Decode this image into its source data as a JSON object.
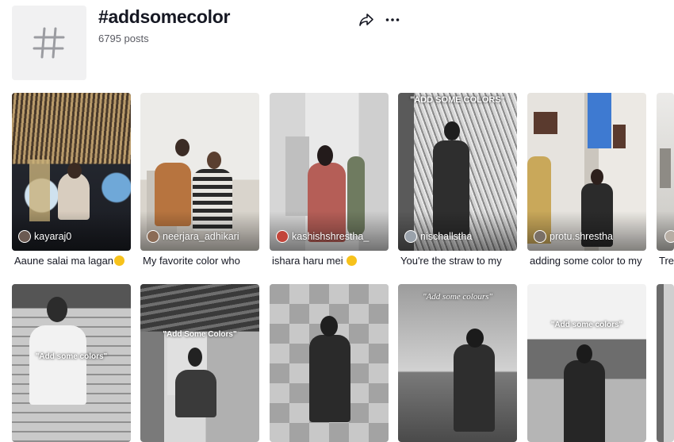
{
  "header": {
    "title": "#addsomecolor",
    "post_count": "6795 posts",
    "hash_symbol": "#"
  },
  "icons": {
    "share": "share-arrow-icon",
    "more": "more-dots-icon"
  },
  "row1": [
    {
      "username": "kayaraj0",
      "caption": "Aaune salai ma lagan",
      "has_emoji": true,
      "overlay": ""
    },
    {
      "username": "neerjara_adhikari",
      "caption": "My favorite color who",
      "has_emoji": false,
      "overlay": ""
    },
    {
      "username": "kashishshrestha_",
      "caption": "ishara haru mei",
      "has_emoji": true,
      "overlay": ""
    },
    {
      "username": "nischallstha",
      "caption": "You're the straw to my",
      "has_emoji": false,
      "overlay": "\"ADD SOME COLORS\""
    },
    {
      "username": "protu.shrestha",
      "caption": "adding some color to my",
      "has_emoji": false,
      "overlay": ""
    },
    {
      "username": "",
      "caption": "Tre",
      "has_emoji": false,
      "overlay": ""
    }
  ],
  "row2": [
    {
      "overlay": "\"Add some colors\""
    },
    {
      "overlay": "\"Add Some Colors\""
    },
    {
      "overlay": ""
    },
    {
      "overlay": "\"Add some colours\""
    },
    {
      "overlay": "\"Add some colors\""
    },
    {
      "overlay": ""
    }
  ],
  "colors": {
    "text": "#161823",
    "muted": "#5a5b63",
    "tag_bg": "#f1f1f2",
    "emoji": "#f7c21b"
  }
}
